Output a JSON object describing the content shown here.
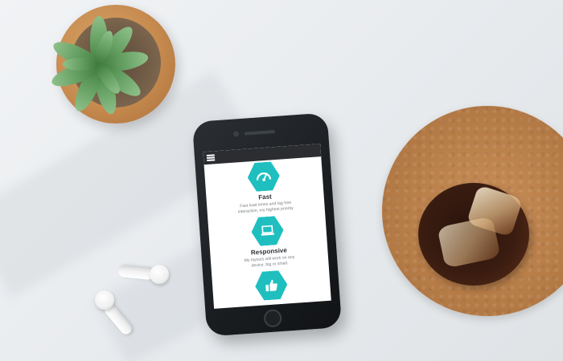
{
  "features": [
    {
      "title": "Fast",
      "line1": "Fast load times and lag free",
      "line2": "interaction, my highest priority.",
      "icon": "speedometer-icon"
    },
    {
      "title": "Responsive",
      "line1": "My layouts will work on any",
      "line2": "device, big or small.",
      "icon": "laptop-icon"
    },
    {
      "title": "",
      "line1": "",
      "line2": "",
      "icon": "thumbs-up-icon"
    }
  ],
  "colors": {
    "accent": "#1fbfc0",
    "app_bar": "#2b2d31",
    "title_text": "#2f3338",
    "body_text": "#7a7f85",
    "cork": "#b67c47",
    "pot": "#c68a4e"
  }
}
